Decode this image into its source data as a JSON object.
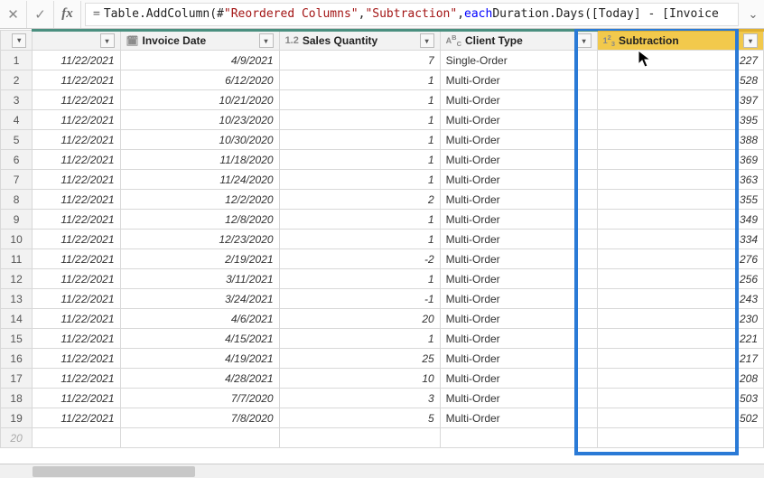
{
  "formula": {
    "eq": "=",
    "p1": " Table.AddColumn(#",
    "s1": "\"Reordered Columns\"",
    "c1": ", ",
    "s2": "\"Subtraction\"",
    "c2": ", ",
    "kw": "each",
    "p2": " Duration.Days([Today] - [Invoice"
  },
  "headers": {
    "invoice": "Invoice Date",
    "qty_type": "1.2",
    "qty": "Sales Quantity",
    "client_type": "ABC",
    "client": "Client Type",
    "sub_type": "123",
    "sub": "Subtraction"
  },
  "rows": [
    {
      "n": 1,
      "today": "11/22/2021",
      "inv": "4/9/2021",
      "qty": 7,
      "client": "Single-Order",
      "sub": 227
    },
    {
      "n": 2,
      "today": "11/22/2021",
      "inv": "6/12/2020",
      "qty": 1,
      "client": "Multi-Order",
      "sub": 528
    },
    {
      "n": 3,
      "today": "11/22/2021",
      "inv": "10/21/2020",
      "qty": 1,
      "client": "Multi-Order",
      "sub": 397
    },
    {
      "n": 4,
      "today": "11/22/2021",
      "inv": "10/23/2020",
      "qty": 1,
      "client": "Multi-Order",
      "sub": 395
    },
    {
      "n": 5,
      "today": "11/22/2021",
      "inv": "10/30/2020",
      "qty": 1,
      "client": "Multi-Order",
      "sub": 388
    },
    {
      "n": 6,
      "today": "11/22/2021",
      "inv": "11/18/2020",
      "qty": 1,
      "client": "Multi-Order",
      "sub": 369
    },
    {
      "n": 7,
      "today": "11/22/2021",
      "inv": "11/24/2020",
      "qty": 1,
      "client": "Multi-Order",
      "sub": 363
    },
    {
      "n": 8,
      "today": "11/22/2021",
      "inv": "12/2/2020",
      "qty": 2,
      "client": "Multi-Order",
      "sub": 355
    },
    {
      "n": 9,
      "today": "11/22/2021",
      "inv": "12/8/2020",
      "qty": 1,
      "client": "Multi-Order",
      "sub": 349
    },
    {
      "n": 10,
      "today": "11/22/2021",
      "inv": "12/23/2020",
      "qty": 1,
      "client": "Multi-Order",
      "sub": 334
    },
    {
      "n": 11,
      "today": "11/22/2021",
      "inv": "2/19/2021",
      "qty": -2,
      "client": "Multi-Order",
      "sub": 276
    },
    {
      "n": 12,
      "today": "11/22/2021",
      "inv": "3/11/2021",
      "qty": 1,
      "client": "Multi-Order",
      "sub": 256
    },
    {
      "n": 13,
      "today": "11/22/2021",
      "inv": "3/24/2021",
      "qty": -1,
      "client": "Multi-Order",
      "sub": 243
    },
    {
      "n": 14,
      "today": "11/22/2021",
      "inv": "4/6/2021",
      "qty": 20,
      "client": "Multi-Order",
      "sub": 230
    },
    {
      "n": 15,
      "today": "11/22/2021",
      "inv": "4/15/2021",
      "qty": 1,
      "client": "Multi-Order",
      "sub": 221
    },
    {
      "n": 16,
      "today": "11/22/2021",
      "inv": "4/19/2021",
      "qty": 25,
      "client": "Multi-Order",
      "sub": 217
    },
    {
      "n": 17,
      "today": "11/22/2021",
      "inv": "4/28/2021",
      "qty": 10,
      "client": "Multi-Order",
      "sub": 208
    },
    {
      "n": 18,
      "today": "11/22/2021",
      "inv": "7/7/2020",
      "qty": 3,
      "client": "Multi-Order",
      "sub": 503
    },
    {
      "n": 19,
      "today": "11/22/2021",
      "inv": "7/8/2020",
      "qty": 5,
      "client": "Multi-Order",
      "sub": 502
    }
  ],
  "last_row_num": 20
}
